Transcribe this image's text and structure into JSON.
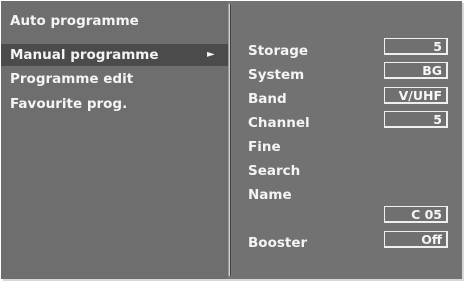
{
  "left_menu": {
    "items": [
      {
        "label": "Auto programme"
      },
      {
        "label": "Manual programme",
        "selected": true,
        "arrow": "►"
      },
      {
        "label": "Programme edit"
      },
      {
        "label": "Favourite prog."
      }
    ]
  },
  "settings": {
    "storage": {
      "label": "Storage",
      "value": "5"
    },
    "system": {
      "label": "System",
      "value": "BG"
    },
    "band": {
      "label": "Band",
      "value": "V/UHF"
    },
    "channel": {
      "label": "Channel",
      "value": "5"
    },
    "fine": {
      "label": "Fine"
    },
    "search": {
      "label": "Search"
    },
    "name": {
      "label": "Name",
      "value": "C 05"
    },
    "booster": {
      "label": "Booster",
      "value": "Off"
    }
  },
  "icons": {
    "submenu_arrow": "right-triangle-icon"
  },
  "colors": {
    "panel_background": "#727272",
    "selected_background": "#4b4b4b",
    "text": "#f4f4f4"
  }
}
